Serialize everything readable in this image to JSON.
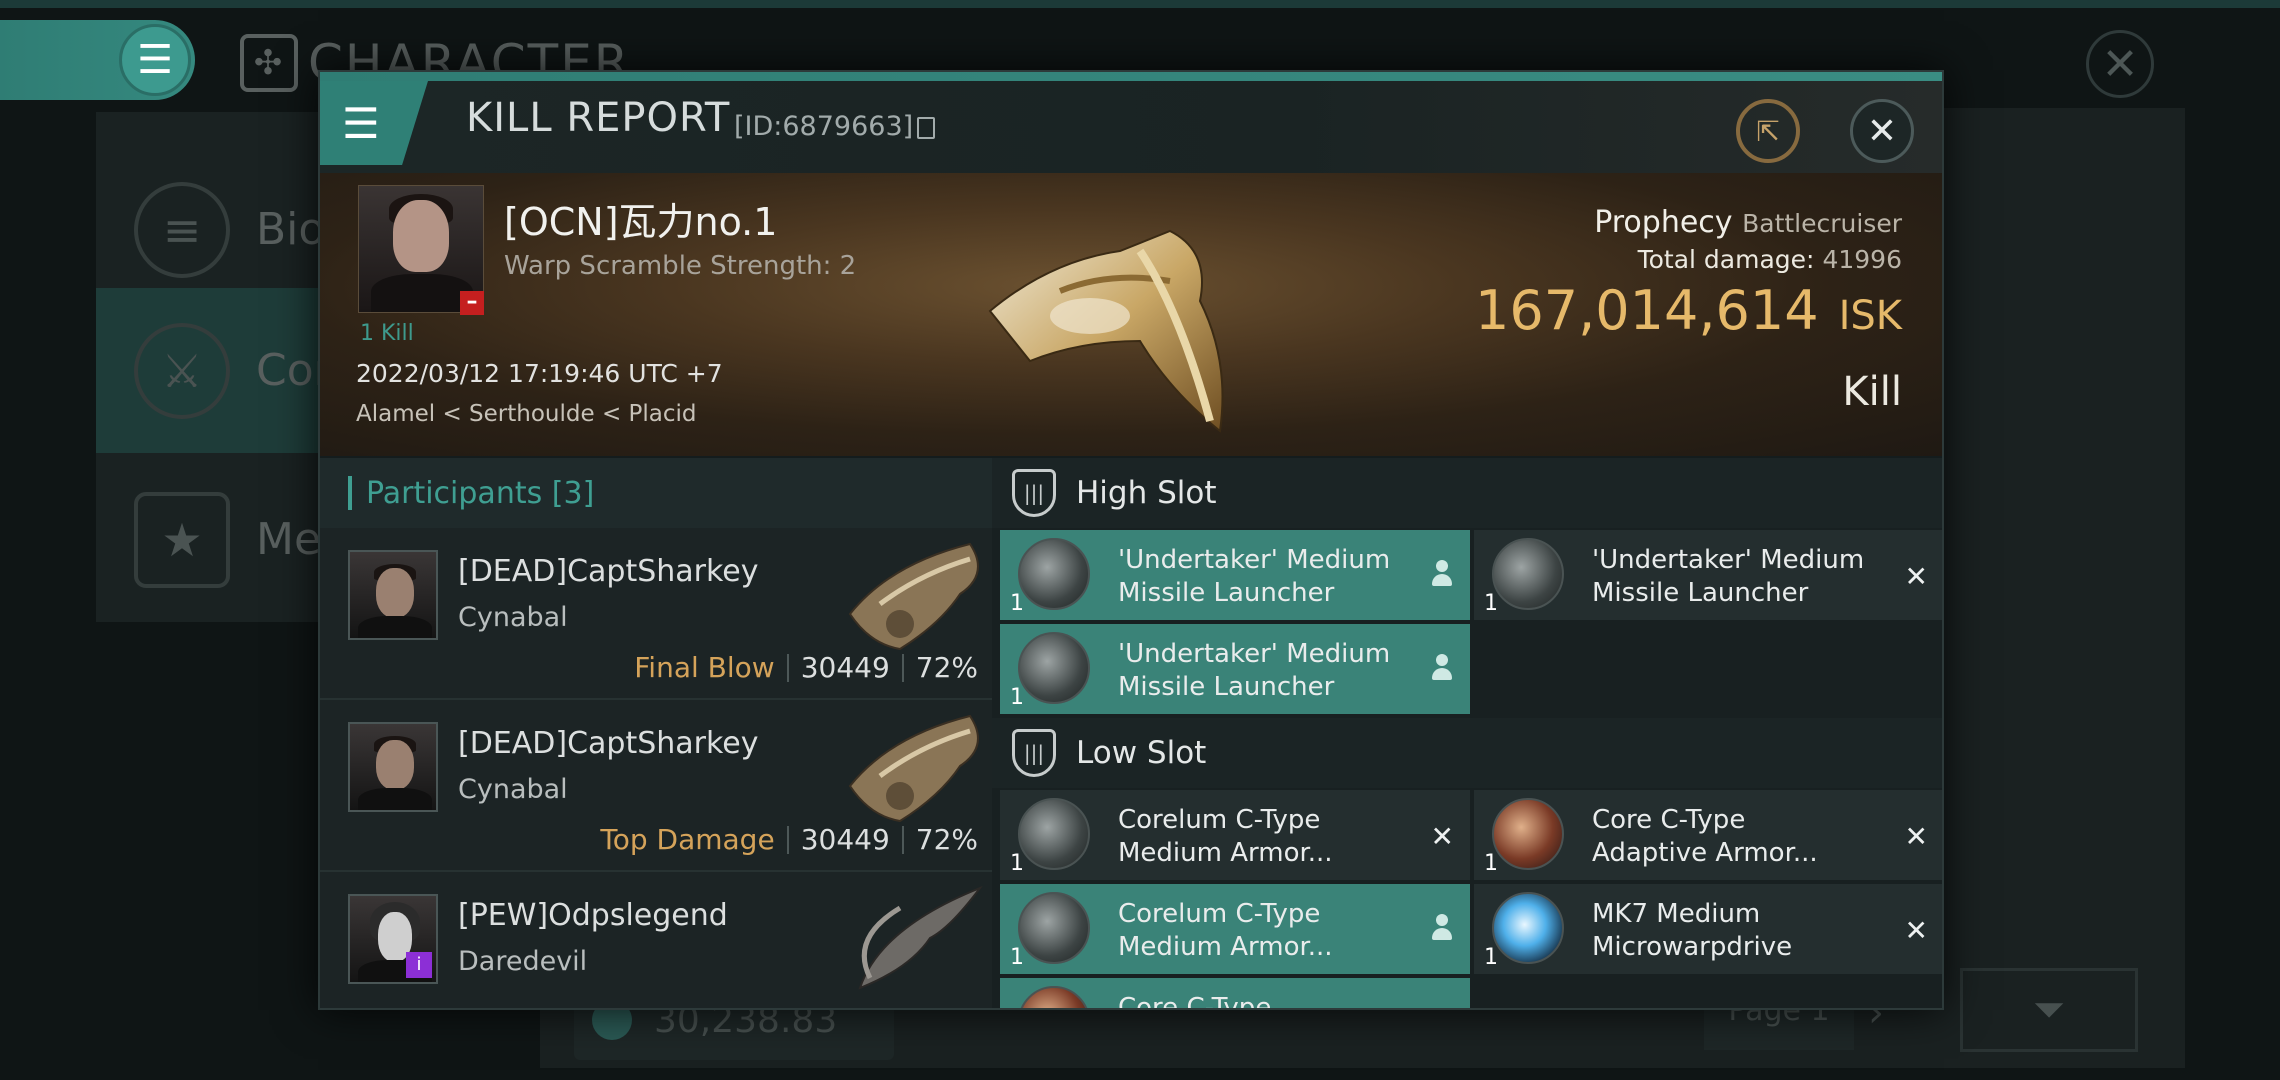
{
  "background": {
    "title": "CHARACTER",
    "sidebar": [
      {
        "label": "Bio"
      },
      {
        "label": "Cor"
      },
      {
        "label": "Med"
      }
    ],
    "bottom_value": "30,238.83",
    "page_label": "Page 1"
  },
  "modal": {
    "title": "KILL REPORT",
    "id_label": "[ID:6879663]",
    "victim": {
      "name": "[OCN]瓦力no.1",
      "subtitle": "Warp Scramble Strength: 2",
      "kill_count": "1 Kill",
      "datetime": "2022/03/12 17:19:46 UTC +7",
      "location": "Alamel < Serthoulde < Placid"
    },
    "ship": {
      "name": "Prophecy",
      "class": "Battlecruiser",
      "total_damage_label": "Total damage:",
      "total_damage": "41996",
      "isk_value": "167,014,614",
      "isk_unit": "ISK",
      "result": "Kill"
    },
    "participants": {
      "title": "Participants",
      "count": "[3]",
      "rows": [
        {
          "name": "[DEAD]CaptSharkey",
          "ship": "Cynabal",
          "tag": "Final Blow",
          "damage": "30449",
          "percent": "72%"
        },
        {
          "name": "[DEAD]CaptSharkey",
          "ship": "Cynabal",
          "tag": "Top Damage",
          "damage": "30449",
          "percent": "72%"
        },
        {
          "name": "[PEW]Odpslegend",
          "ship": "Daredevil",
          "tag": "",
          "damage": "",
          "percent": ""
        }
      ]
    },
    "high_slot": {
      "title": "High Slot",
      "items": [
        {
          "qty": "1",
          "name_line1": "'Undertaker' Medium",
          "name_line2": "Missile Launcher",
          "status": "destroyed-by-user"
        },
        {
          "qty": "1",
          "name_line1": "'Undertaker' Medium",
          "name_line2": "Missile Launcher",
          "status": "dropped"
        },
        {
          "qty": "1",
          "name_line1": "'Undertaker' Medium",
          "name_line2": "Missile Launcher",
          "status": "destroyed-by-user"
        }
      ]
    },
    "low_slot": {
      "title": "Low Slot",
      "items": [
        {
          "qty": "1",
          "name_line1": "Corelum C-Type",
          "name_line2": "Medium Armor...",
          "status": "dropped"
        },
        {
          "qty": "1",
          "name_line1": "Core C-Type",
          "name_line2": "Adaptive Armor...",
          "status": "dropped"
        },
        {
          "qty": "1",
          "name_line1": "Corelum C-Type",
          "name_line2": "Medium Armor...",
          "status": "destroyed-by-user"
        },
        {
          "qty": "1",
          "name_line1": "MK7 Medium",
          "name_line2": "Microwarpdrive",
          "status": "dropped"
        },
        {
          "qty": "",
          "name_line1": "Core C-Type",
          "name_line2": "",
          "status": "destroyed-by-user"
        }
      ]
    }
  },
  "icons": {
    "menu": "hamburger-icon",
    "share": "share-icon",
    "close": "close-icon",
    "copy": "copy-icon",
    "shield": "shield-slot-icon",
    "person": "person-icon"
  },
  "colors": {
    "accent": "#2f8076",
    "isk": "#e6b96a",
    "tag": "#d5a35a",
    "highlight_row": "#3a8378"
  }
}
